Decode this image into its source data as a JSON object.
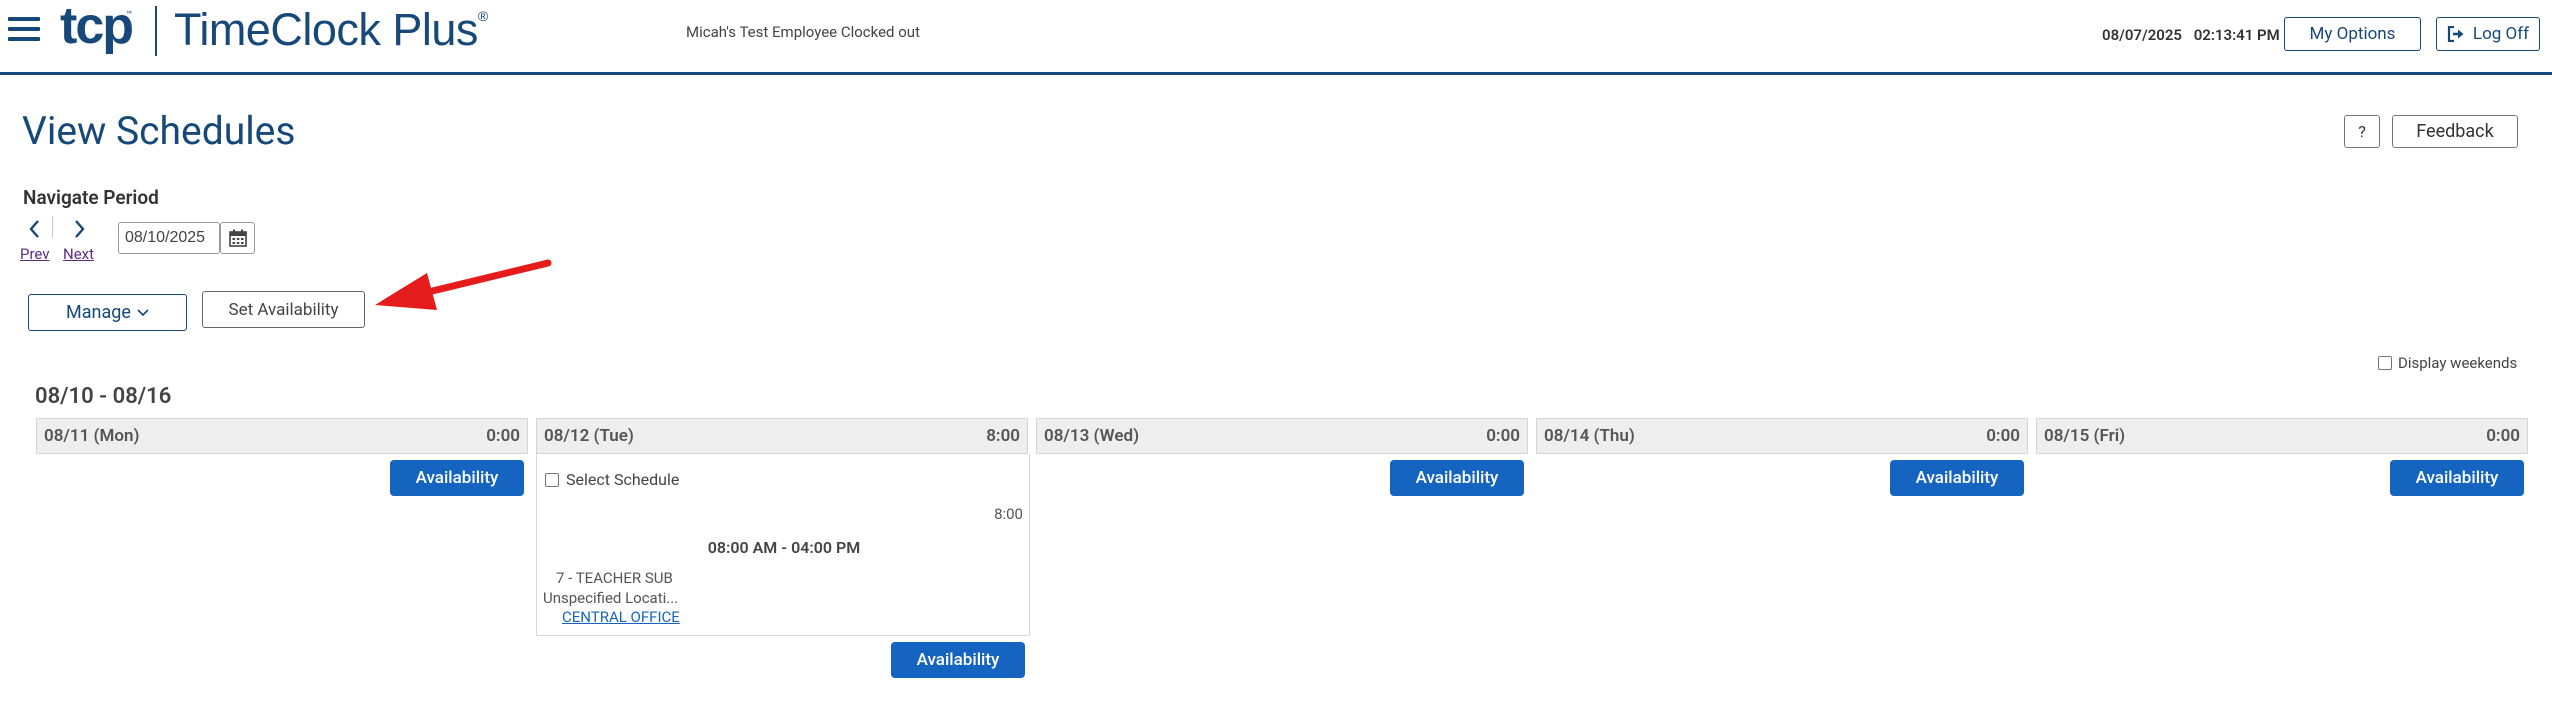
{
  "header": {
    "logo_tcp": "tcp",
    "logo_tm": "™",
    "logo_name": "TimeClock Plus",
    "logo_reg": "®",
    "status": "Micah's Test Employee Clocked out",
    "date": "08/07/2025",
    "time": "02:13:41 PM",
    "my_options": "My Options",
    "log_off": "Log Off"
  },
  "page": {
    "title": "View Schedules",
    "help": "?",
    "feedback": "Feedback"
  },
  "navigate": {
    "label": "Navigate Period",
    "prev": "Prev",
    "next": "Next",
    "date_value": "08/10/2025"
  },
  "actions": {
    "manage": "Manage",
    "set_availability": "Set Availability"
  },
  "display_weekends": "Display weekends",
  "week": {
    "range": "08/10 - 08/16",
    "days": [
      {
        "label": "08/11 (Mon)",
        "hours": "0:00",
        "availability": "Availability"
      },
      {
        "label": "08/12 (Tue)",
        "hours": "8:00",
        "availability": "Availability",
        "schedule": {
          "select_label": "Select Schedule",
          "hours": "8:00",
          "time": "08:00 AM - 04:00 PM",
          "job": "7 - TEACHER SUB",
          "location": "Unspecified Locati...",
          "link": "CENTRAL OFFICE"
        }
      },
      {
        "label": "08/13 (Wed)",
        "hours": "0:00",
        "availability": "Availability"
      },
      {
        "label": "08/14 (Thu)",
        "hours": "0:00",
        "availability": "Availability"
      },
      {
        "label": "08/15 (Fri)",
        "hours": "0:00",
        "availability": "Availability"
      }
    ]
  },
  "colors": {
    "brand": "#16487a",
    "accent_green": "#7cbf2f",
    "button_blue": "#1565c0",
    "arrow_red": "#e51c1c"
  },
  "icons": [
    "hamburger-icon",
    "logout-icon",
    "chevron-left-icon",
    "chevron-right-icon",
    "calendar-icon",
    "chevron-down-icon",
    "red-arrow-annotation"
  ]
}
